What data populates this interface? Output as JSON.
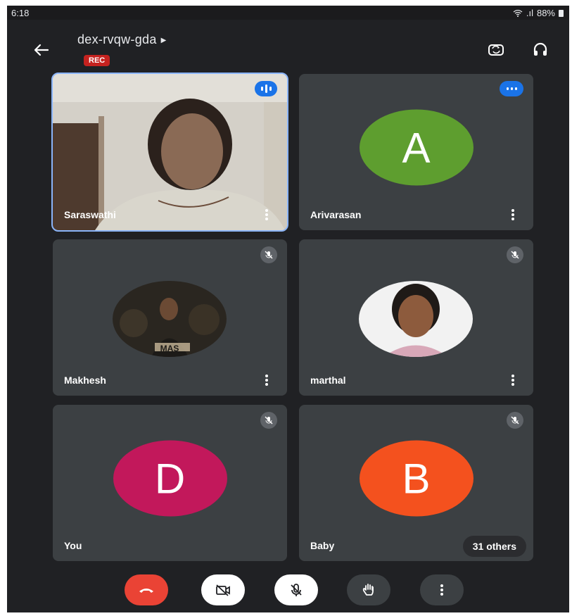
{
  "status_bar": {
    "time": "6:18",
    "battery": "88%",
    "signal": ".ıl"
  },
  "header": {
    "meeting_code": "dex-rvqw-gda",
    "rec_label": "REC"
  },
  "tiles": [
    {
      "name": "Saraswathi",
      "kind": "video",
      "speaking": true
    },
    {
      "name": "Arivarasan",
      "kind": "avatar",
      "initial": "A",
      "avatar_color": "#5e9e2f"
    },
    {
      "name": "Makhesh",
      "kind": "photo",
      "photo_text": "MAS"
    },
    {
      "name": "marthal",
      "kind": "photo"
    },
    {
      "name": "You",
      "kind": "avatar",
      "initial": "D",
      "avatar_color": "#c2185b"
    },
    {
      "name": "Baby",
      "kind": "avatar",
      "initial": "B",
      "avatar_color": "#f4511e",
      "others_label": "31 others"
    }
  ],
  "controls": [
    {
      "name": "end-call",
      "icon": "phone-hangup-icon",
      "color": "#ea4335"
    },
    {
      "name": "camera-off",
      "icon": "camera-off-icon",
      "color": "#ffffff"
    },
    {
      "name": "mic-off",
      "icon": "mic-off-icon",
      "color": "#ffffff"
    },
    {
      "name": "raise-hand",
      "icon": "hand-icon",
      "color": "#3c4043"
    },
    {
      "name": "more-options",
      "icon": "more-vert-icon",
      "color": "#3c4043"
    }
  ],
  "colors": {
    "background": "#202124",
    "tile": "#3c4043",
    "accent": "#8ab4f8",
    "rec": "#c5221f"
  }
}
